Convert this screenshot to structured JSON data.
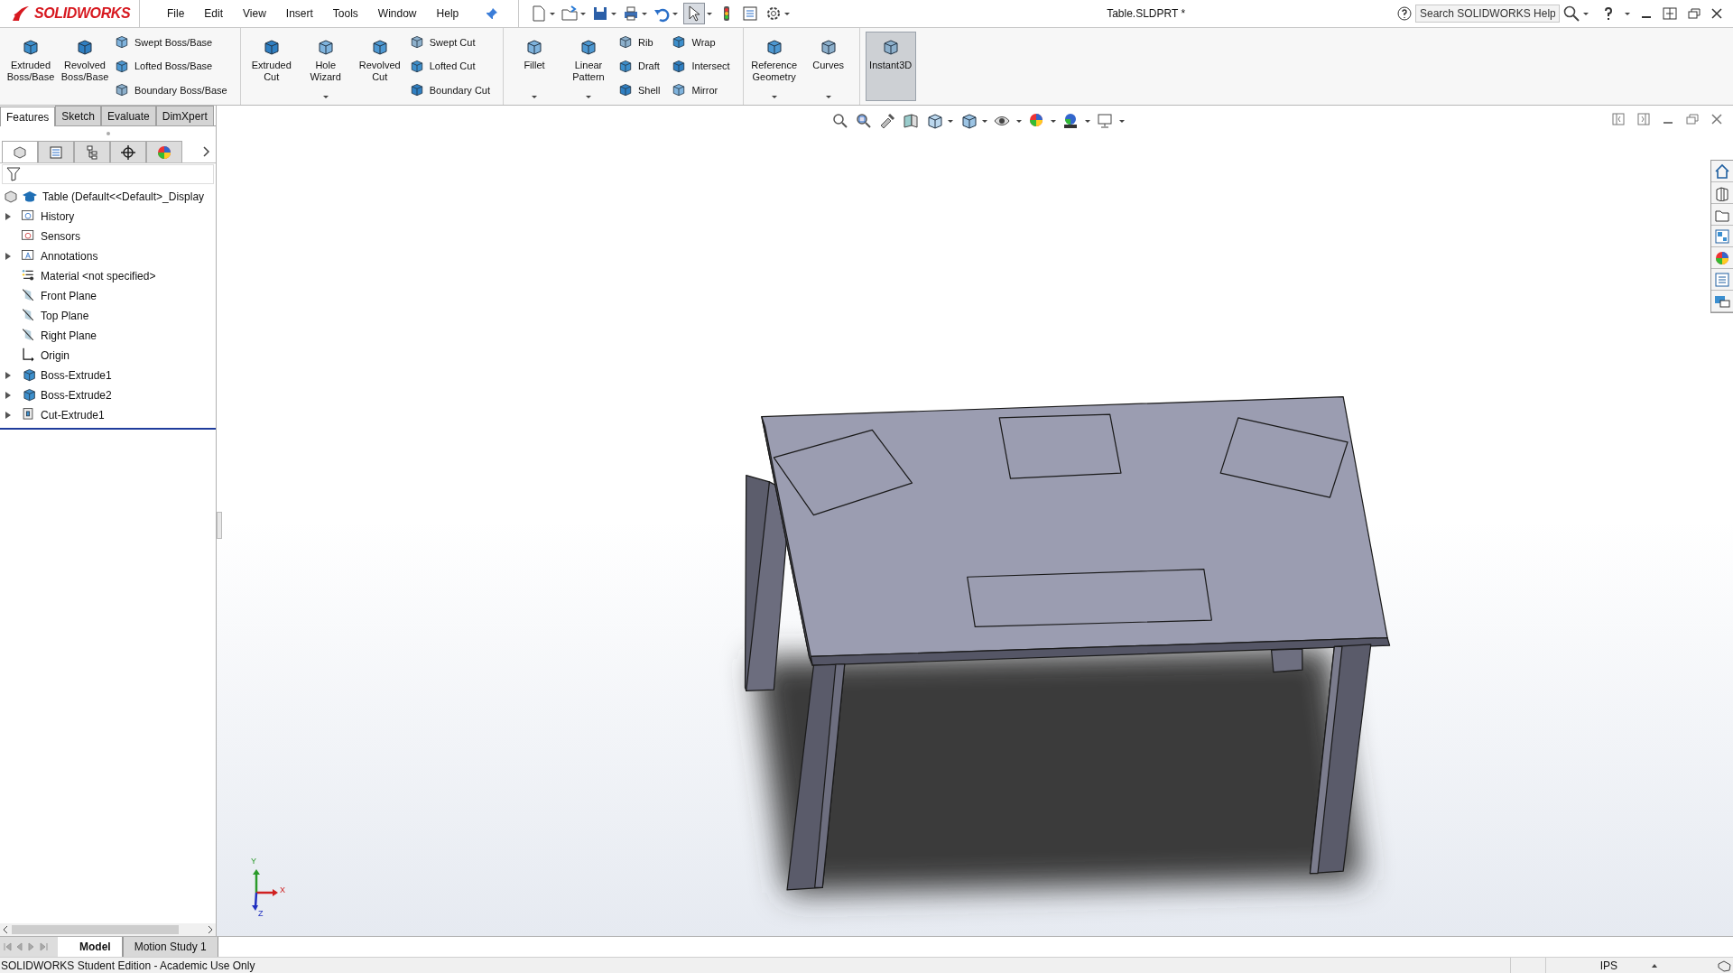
{
  "title_bar": {
    "logo": "SOLIDWORKS",
    "menus": [
      "File",
      "Edit",
      "View",
      "Insert",
      "Tools",
      "Window",
      "Help"
    ],
    "select_tool_on": true,
    "document_title": "Table.SLDPRT *",
    "search": {
      "placeholder": "Search SOLIDWORKS Help"
    }
  },
  "ribbon": {
    "groups": [
      {
        "items": [
          {
            "kind": "large",
            "label": "Extruded Boss/Base",
            "dropdown": false,
            "on": false
          },
          {
            "kind": "large",
            "label": "Revolved Boss/Base",
            "dropdown": false,
            "on": false
          },
          {
            "kind": "stack",
            "labels": [
              "Swept Boss/Base",
              "Lofted Boss/Base",
              "Boundary Boss/Base"
            ]
          }
        ]
      },
      {
        "items": [
          {
            "kind": "large",
            "label": "Extruded Cut",
            "dropdown": false,
            "on": false
          },
          {
            "kind": "large",
            "label": "Hole Wizard",
            "dropdown": true,
            "on": false
          },
          {
            "kind": "large",
            "label": "Revolved Cut",
            "dropdown": false,
            "on": false
          },
          {
            "kind": "stack",
            "labels": [
              "Swept Cut",
              "Lofted Cut",
              "Boundary Cut"
            ]
          }
        ]
      },
      {
        "items": [
          {
            "kind": "large",
            "label": "Fillet",
            "dropdown": true,
            "on": false
          },
          {
            "kind": "large",
            "label": "Linear Pattern",
            "dropdown": true,
            "on": false
          },
          {
            "kind": "stack",
            "labels": [
              "Rib",
              "Draft",
              "Shell"
            ]
          },
          {
            "kind": "stack",
            "labels": [
              "Wrap",
              "Intersect",
              "Mirror"
            ]
          }
        ]
      },
      {
        "items": [
          {
            "kind": "large",
            "label": "Reference Geometry",
            "dropdown": true,
            "on": false
          },
          {
            "kind": "large",
            "label": "Curves",
            "dropdown": true,
            "on": false
          }
        ]
      },
      {
        "items": [
          {
            "kind": "large",
            "label": "Instant3D",
            "dropdown": false,
            "on": true
          }
        ]
      }
    ]
  },
  "command_tabs": [
    {
      "label": "Features",
      "selected": true
    },
    {
      "label": "Sketch",
      "selected": false
    },
    {
      "label": "Evaluate",
      "selected": false
    },
    {
      "label": "DimXpert",
      "selected": false
    }
  ],
  "feature_manager": {
    "panel_tabs": [
      {
        "selected": true
      },
      {
        "selected": false
      },
      {
        "selected": false
      },
      {
        "selected": false
      },
      {
        "selected": false
      }
    ],
    "tree": {
      "label": "Table  (Default<<Default>_Display",
      "children": [
        {
          "label": "History",
          "collapsed": true
        },
        {
          "label": "Sensors",
          "collapsed": false
        },
        {
          "label": "Annotations",
          "collapsed": true
        },
        {
          "label": "Material <not specified>",
          "collapsed": false
        },
        {
          "label": "Front Plane",
          "collapsed": false
        },
        {
          "label": "Top Plane",
          "collapsed": false
        },
        {
          "label": "Right Plane",
          "collapsed": false
        },
        {
          "label": "Origin",
          "collapsed": false
        },
        {
          "label": "Boss-Extrude1",
          "collapsed": true
        },
        {
          "label": "Boss-Extrude2",
          "collapsed": true
        },
        {
          "label": "Cut-Extrude1",
          "collapsed": true
        }
      ]
    }
  },
  "graphics_area": {
    "triad": {
      "x_label": "X",
      "y_label": "Y",
      "z_label": "Z"
    }
  },
  "bottom_tabs": [
    {
      "label": "Model",
      "selected": true
    },
    {
      "label": "Motion Study 1",
      "selected": false
    }
  ],
  "status_bar": {
    "message": "SOLIDWORKS Student Edition - Academic Use Only",
    "units": "IPS"
  }
}
